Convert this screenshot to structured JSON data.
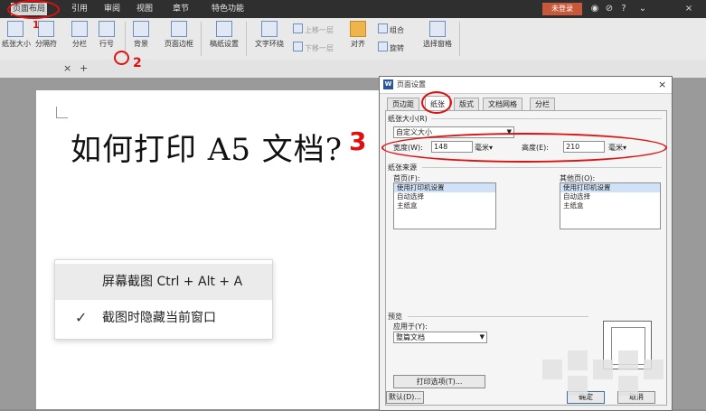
{
  "menubar": {
    "tabs": [
      "页面布局",
      "引用",
      "审阅",
      "视图",
      "章节",
      "特色功能"
    ],
    "login": "未登录",
    "icons": [
      "user-icon",
      "help-icon",
      "question-icon",
      "minimize-icon",
      "close-icon"
    ]
  },
  "ribbon": {
    "items": [
      "纸张大小",
      "分隔符",
      "分栏",
      "行号",
      "背景",
      "页面边框",
      "稿纸设置",
      "文字环绕",
      "对齐",
      "旋转",
      "选择窗格"
    ],
    "small": [
      "上移一层",
      "下移一层",
      "组合"
    ]
  },
  "tabstrip": {
    "close": "×",
    "add": "+"
  },
  "document": {
    "heading": "如何打印 A5 文档?"
  },
  "context_menu": {
    "items": [
      {
        "label": "屏幕截图 Ctrl + Alt + A",
        "checked": false
      },
      {
        "label": "截图时隐藏当前窗口",
        "checked": true
      }
    ]
  },
  "dialog": {
    "title": "页面设置",
    "tabs": [
      "页边距",
      "纸张",
      "版式",
      "文档网格",
      "分栏"
    ],
    "active_tab": "纸张",
    "paper_size_label": "纸张大小(R)",
    "paper_size_value": "自定义大小",
    "width_label": "宽度(W):",
    "width_value": "148",
    "width_unit": "毫米",
    "height_label": "高度(E):",
    "height_value": "210",
    "height_unit": "毫米",
    "source_label": "纸张来源",
    "first_page_label": "首页(F):",
    "other_pages_label": "其他页(O):",
    "first_page_options": [
      "使用打印机设置",
      "自动选择",
      "主纸盒"
    ],
    "other_pages_options": [
      "使用打印机设置",
      "自动选择",
      "主纸盒"
    ],
    "preview_label": "预览",
    "apply_label": "应用于(Y):",
    "apply_value": "整篇文档",
    "print_options": "打印选项(T)...",
    "default_button": "默认(D)...",
    "ok_button": "确定",
    "cancel_button": "取消"
  },
  "annotations": {
    "n1": "1",
    "n2": "2",
    "n3": "3",
    "color": "#e01010"
  }
}
